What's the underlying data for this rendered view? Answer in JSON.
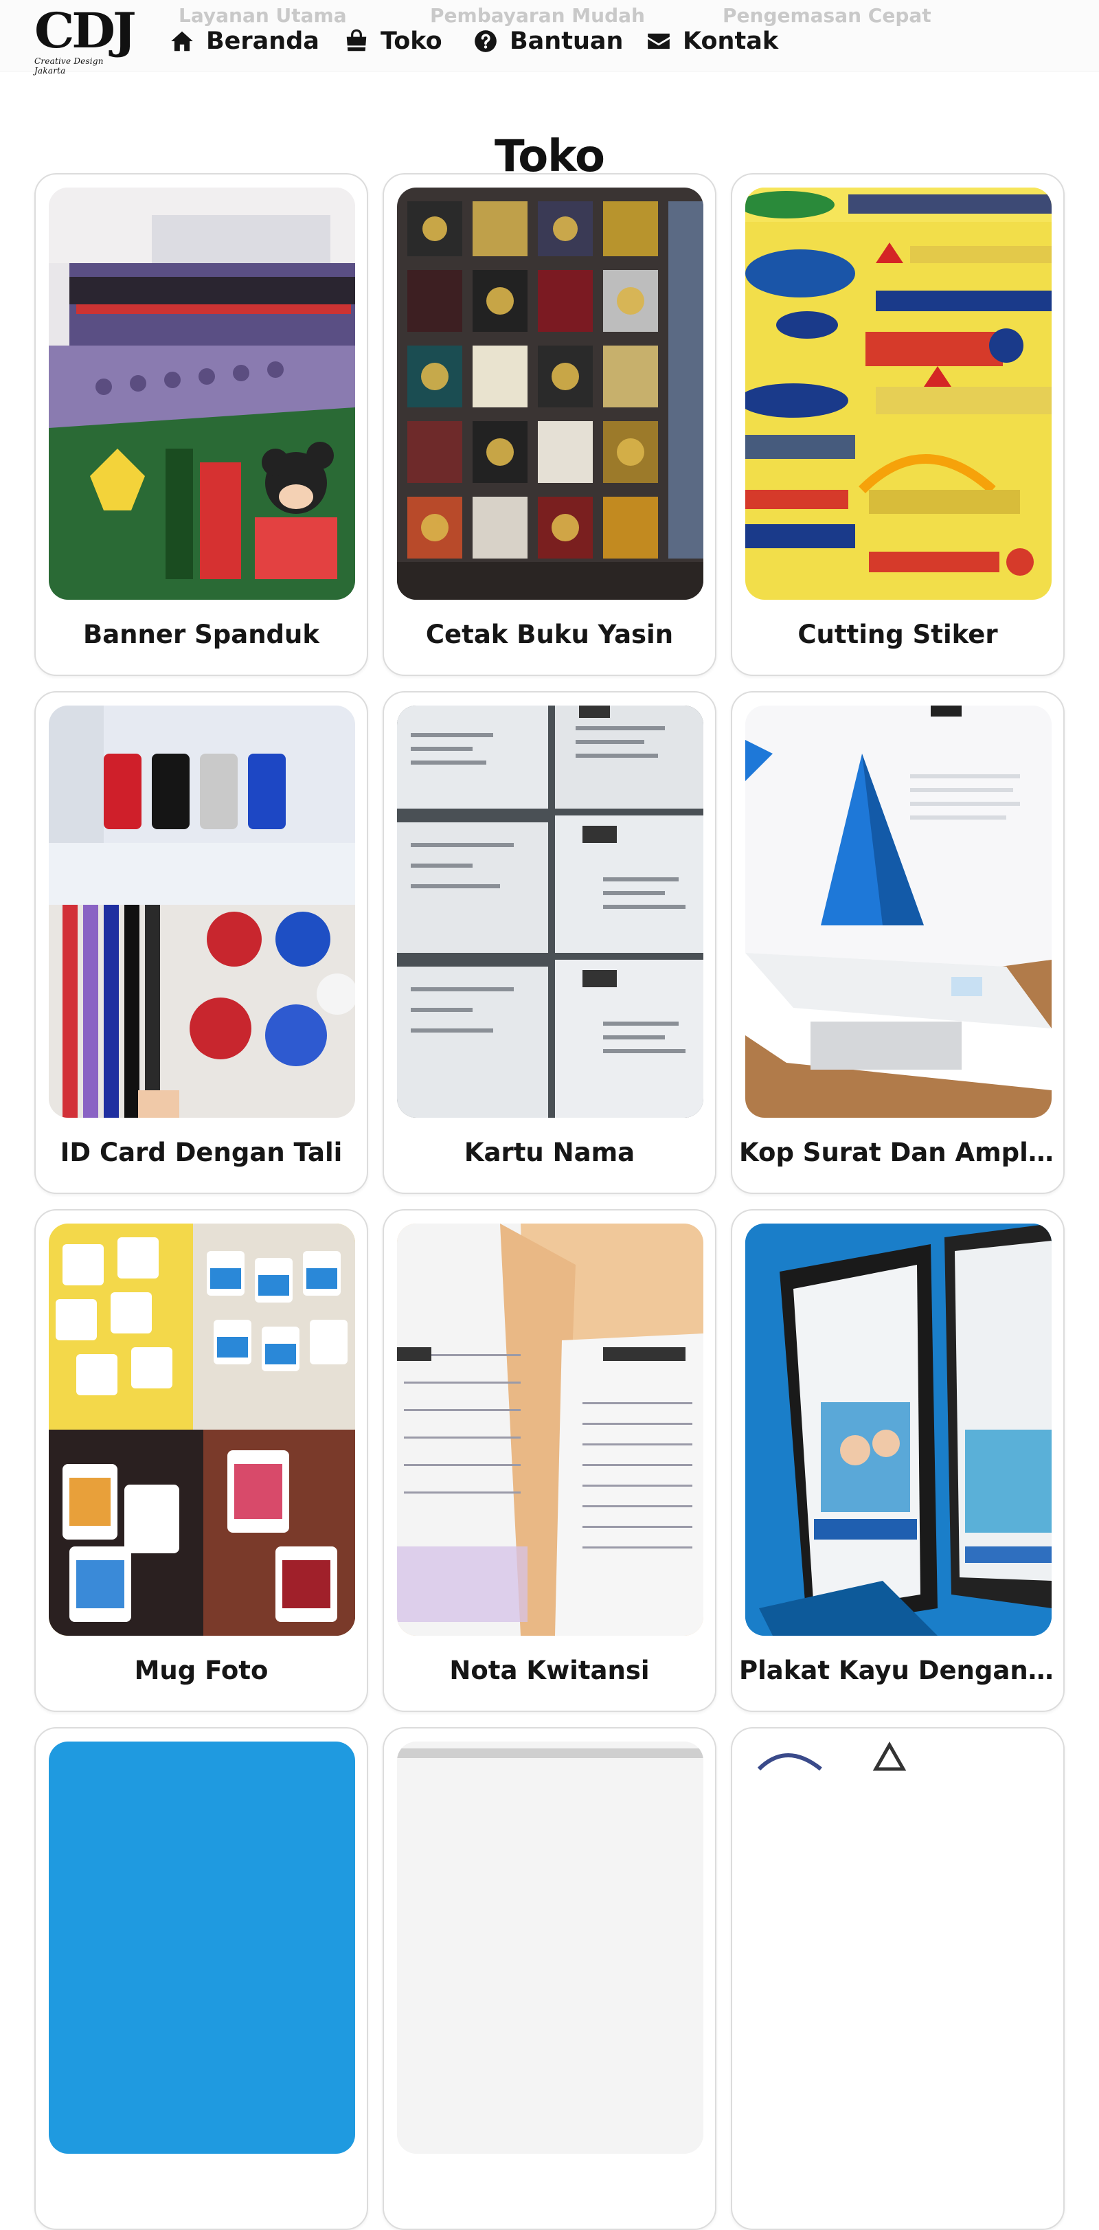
{
  "header": {
    "logo": {
      "mark": "CDJ",
      "subtitle": "Creative Design Jakarta"
    },
    "taglines": [
      "Layanan Utama",
      "Pembayaran Mudah",
      "Pengemasan Cepat"
    ],
    "nav": [
      {
        "label": "Beranda",
        "icon": "home-icon"
      },
      {
        "label": "Toko",
        "icon": "shopping-bag-icon"
      },
      {
        "label": "Bantuan",
        "icon": "question-circle-icon"
      },
      {
        "label": "Kontak",
        "icon": "envelope-icon"
      }
    ]
  },
  "page": {
    "title": "Toko"
  },
  "products": [
    {
      "name": "Banner Spanduk"
    },
    {
      "name": "Cetak Buku Yasin"
    },
    {
      "name": "Cutting Stiker"
    },
    {
      "name": "ID Card Dengan Tali"
    },
    {
      "name": "Kartu Nama"
    },
    {
      "name": "Kop Surat Dan Amplop"
    },
    {
      "name": "Mug Foto"
    },
    {
      "name": "Nota Kwitansi"
    },
    {
      "name": "Plakat Kayu Dengan ..."
    }
  ],
  "colors": {
    "header_bg": "#fbfbfb",
    "tagline": "#c9c9c9",
    "text": "#151515",
    "card_border": "#dcdcdc"
  }
}
